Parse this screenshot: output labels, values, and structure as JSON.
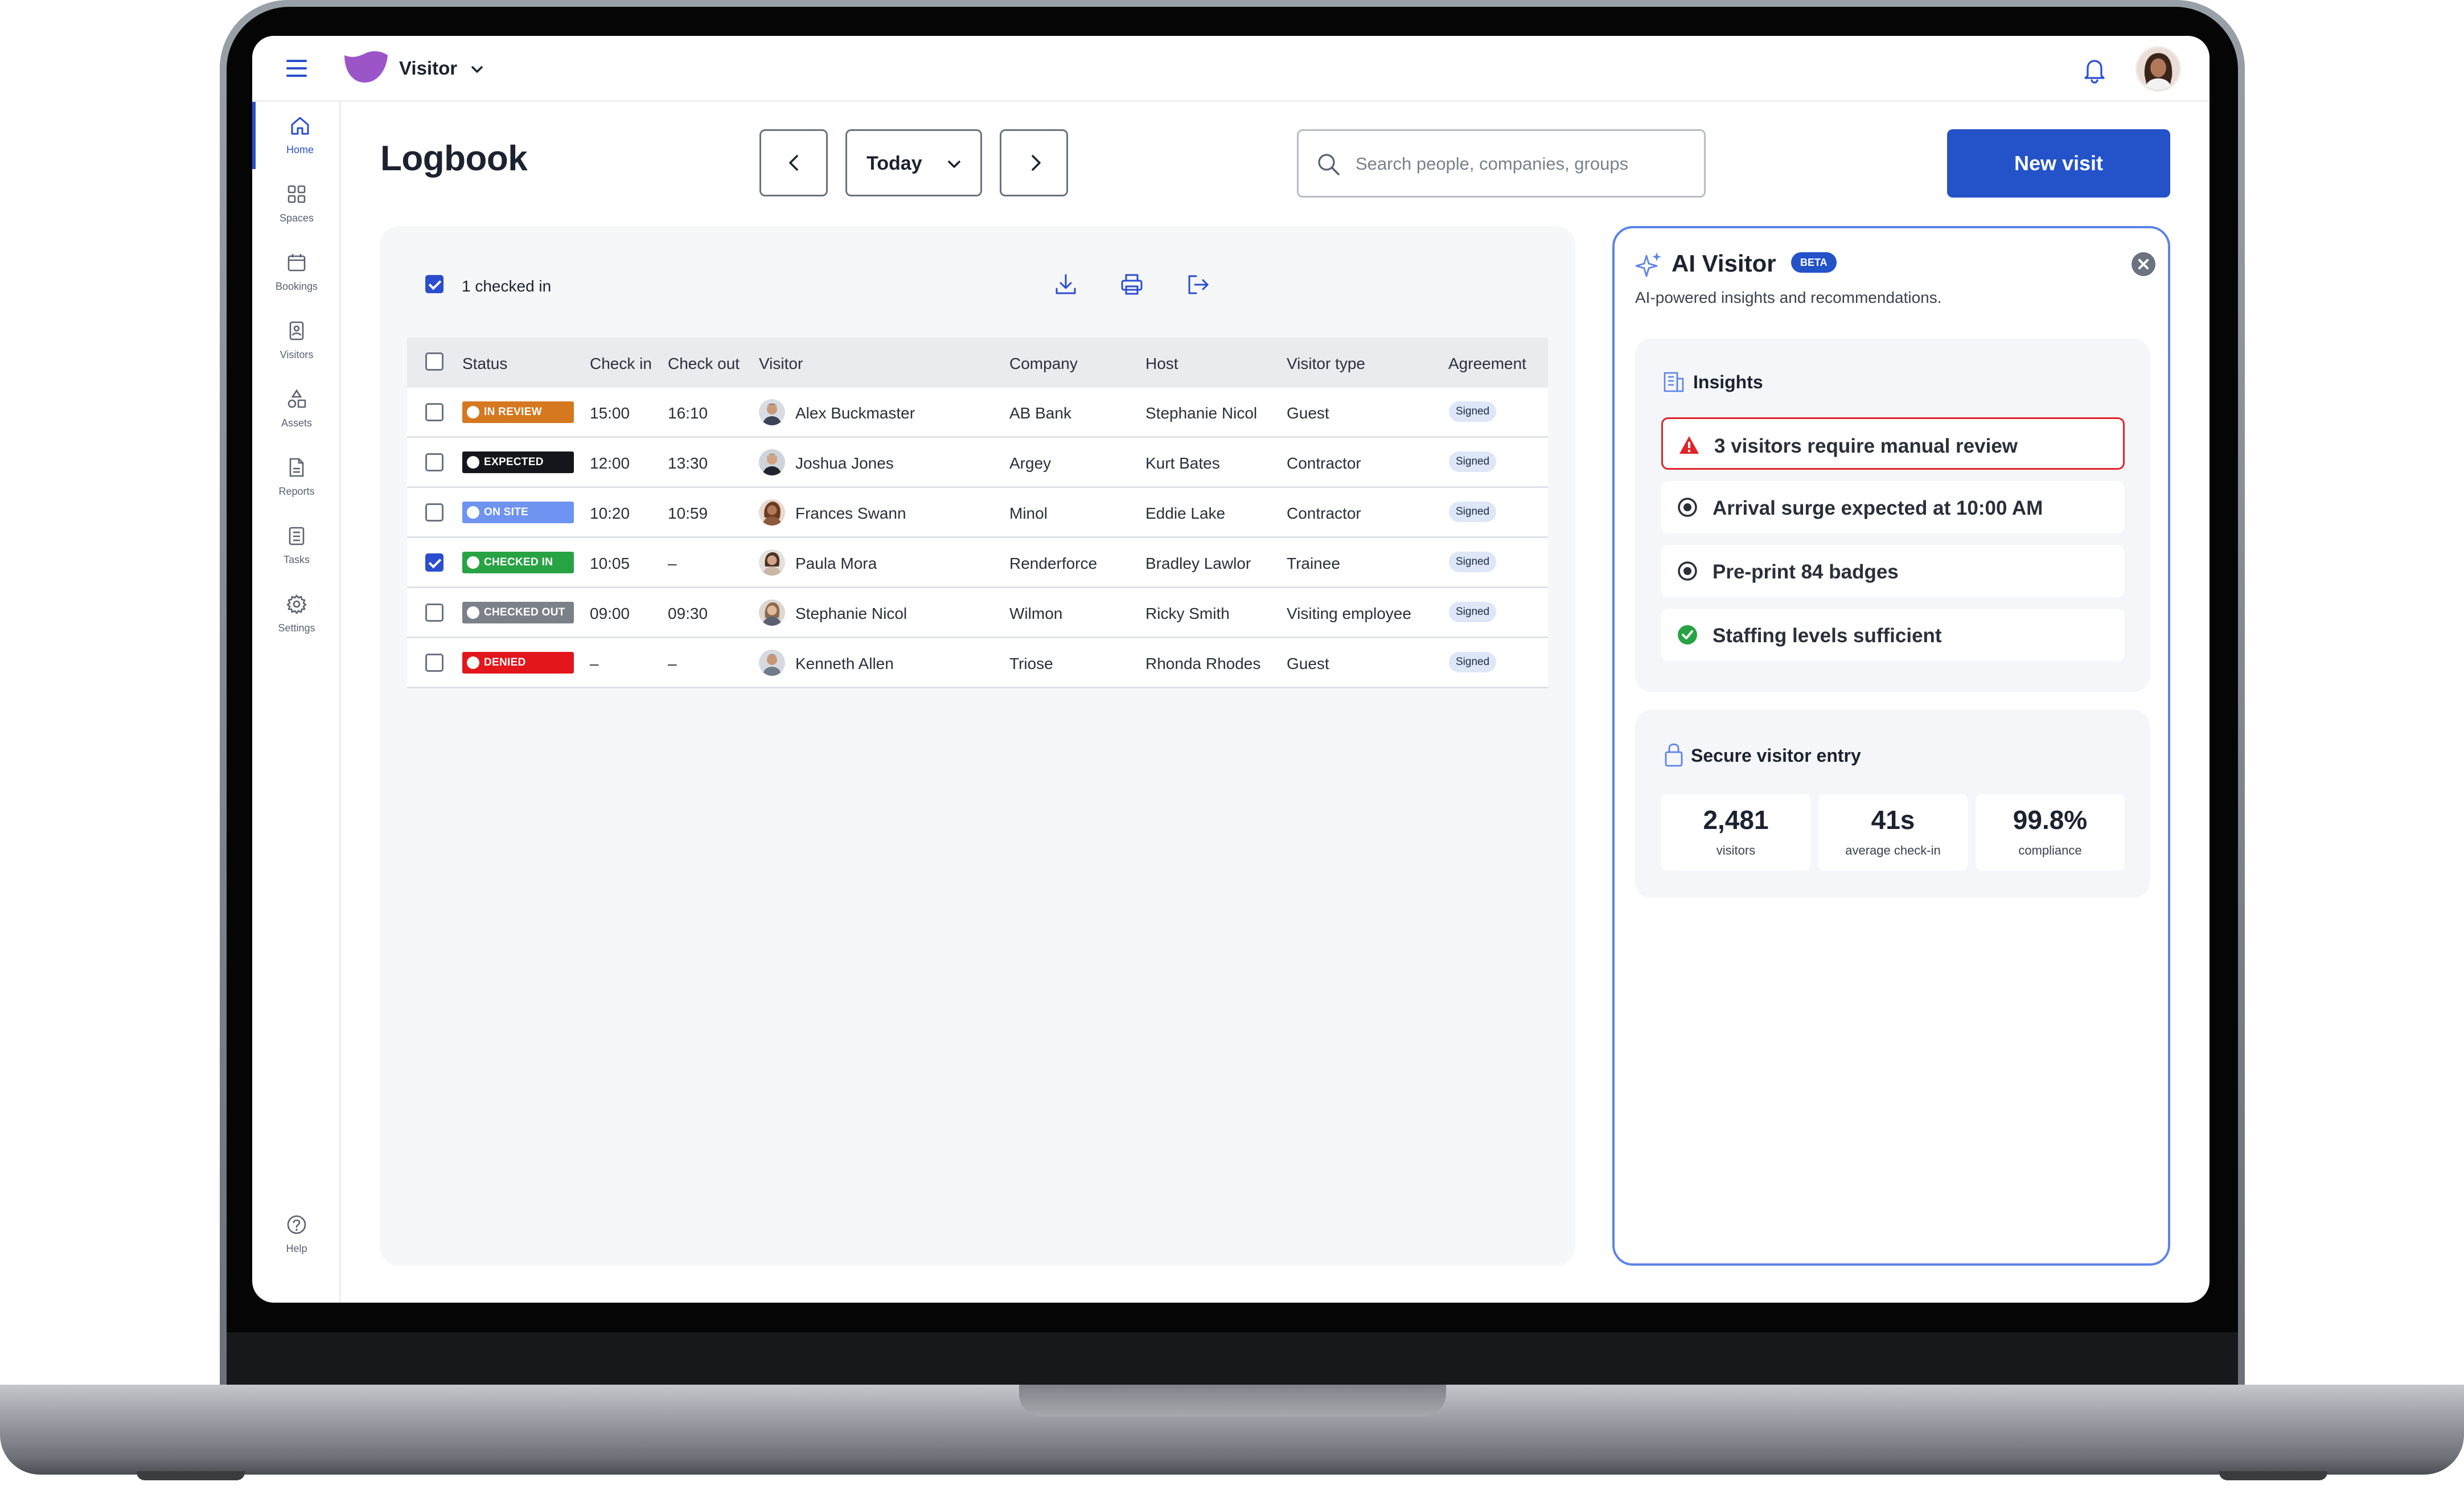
{
  "app": {
    "name": "Visitor"
  },
  "page": {
    "title": "Logbook"
  },
  "nav": [
    {
      "label": "Home",
      "icon": "home-icon"
    },
    {
      "label": "Spaces",
      "icon": "grid-icon"
    },
    {
      "label": "Bookings",
      "icon": "calendar-icon"
    },
    {
      "label": "Visitors",
      "icon": "badge-icon"
    },
    {
      "label": "Assets",
      "icon": "shapes-icon"
    },
    {
      "label": "Reports",
      "icon": "document-icon"
    },
    {
      "label": "Tasks",
      "icon": "checklist-icon"
    },
    {
      "label": "Settings",
      "icon": "gear-icon"
    },
    {
      "label": "Help",
      "icon": "help-icon"
    }
  ],
  "date_picker": {
    "selected": "Today"
  },
  "search": {
    "placeholder": "Search people, companies, groups"
  },
  "actions": {
    "new_visit": "New visit"
  },
  "logbook": {
    "selection_label": "1 checked in",
    "columns": [
      "Status",
      "Check in",
      "Check out",
      "Visitor",
      "Company",
      "Host",
      "Visitor type",
      "Agreement"
    ],
    "rows": [
      {
        "status": "IN REVIEW",
        "check_in": "15:00",
        "check_out": "16:10",
        "visitor": "Alex Buckmaster",
        "company": "AB Bank",
        "host": "Stephanie Nicol",
        "type": "Guest",
        "agreement": "Signed",
        "selected": false
      },
      {
        "status": "EXPECTED",
        "check_in": "12:00",
        "check_out": "13:30",
        "visitor": "Joshua Jones",
        "company": "Argey",
        "host": "Kurt Bates",
        "type": "Contractor",
        "agreement": "Signed",
        "selected": false
      },
      {
        "status": "ON SITE",
        "check_in": "10:20",
        "check_out": "10:59",
        "visitor": "Frances Swann",
        "company": "Minol",
        "host": "Eddie Lake",
        "type": "Contractor",
        "agreement": "Signed",
        "selected": false
      },
      {
        "status": "CHECKED IN",
        "check_in": "10:05",
        "check_out": "–",
        "visitor": "Paula Mora",
        "company": "Renderforce",
        "host": "Bradley Lawlor",
        "type": "Trainee",
        "agreement": "Signed",
        "selected": true
      },
      {
        "status": "CHECKED OUT",
        "check_in": "09:00",
        "check_out": "09:30",
        "visitor": "Stephanie Nicol",
        "company": "Wilmon",
        "host": "Ricky Smith",
        "type": "Visiting employee",
        "agreement": "Signed",
        "selected": false
      },
      {
        "status": "DENIED",
        "check_in": "–",
        "check_out": "–",
        "visitor": "Kenneth Allen",
        "company": "Triose",
        "host": "Rhonda Rhodes",
        "type": "Guest",
        "agreement": "Signed",
        "selected": false
      }
    ]
  },
  "status_colors": {
    "IN REVIEW": "#d5781f",
    "EXPECTED": "#14161b",
    "ON SITE": "#6e93f0",
    "CHECKED IN": "#27a344",
    "CHECKED OUT": "#7c8088",
    "DENIED": "#e3161b"
  },
  "ai": {
    "title": "AI Visitor",
    "badge": "BETA",
    "subtitle": "AI-powered insights and recommendations.",
    "insights_title": "Insights",
    "insights": [
      {
        "text": "3 visitors require manual review",
        "icon": "warning-icon"
      },
      {
        "text": "Arrival surge expected at 10:00 AM",
        "icon": "radio-icon"
      },
      {
        "text": "Pre-print 84 badges",
        "icon": "radio-icon"
      },
      {
        "text": "Staffing levels sufficient",
        "icon": "check-circle-icon"
      }
    ],
    "secure_title": "Secure visitor entry",
    "stats": [
      {
        "value": "2,481",
        "label": "visitors"
      },
      {
        "value": "41s",
        "label": "average check-in"
      },
      {
        "value": "99.8%",
        "label": "compliance"
      }
    ]
  },
  "colors": {
    "accent": "#2352c9",
    "brand": "#9c55c9",
    "alert": "#e0242b",
    "success": "#27a344"
  }
}
